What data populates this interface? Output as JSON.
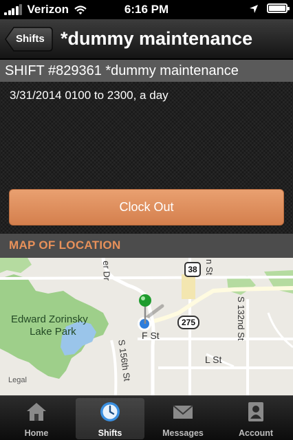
{
  "status_bar": {
    "carrier": "Verizon",
    "time": "6:16 PM",
    "battery_level": 1.0
  },
  "nav": {
    "back_label": "Shifts",
    "title": "*dummy maintenance"
  },
  "shift": {
    "header": "SHIFT #829361 *dummy maintenance",
    "detail": "3/31/2014 0100 to 2300, a day"
  },
  "actions": {
    "clock_out_label": "Clock Out"
  },
  "map": {
    "section_title": "MAP OF LOCATION",
    "park_name_line1": "Edward Zorinsky",
    "park_name_line2": "Lake Park",
    "route_38": "38",
    "route_275": "275",
    "streets": {
      "f_st": "F St",
      "l_st": "L St",
      "s_132nd": "S 132nd St",
      "s_156th": "S 156th St",
      "er_dr": "er Dr",
      "n_st": "n St"
    },
    "legal": "Legal"
  },
  "tabs": [
    {
      "label": "Home",
      "icon": "home-icon",
      "active": false
    },
    {
      "label": "Shifts",
      "icon": "clock-icon",
      "active": true
    },
    {
      "label": "Messages",
      "icon": "envelope-icon",
      "active": false
    },
    {
      "label": "Account",
      "icon": "account-icon",
      "active": false
    }
  ],
  "colors": {
    "accent_orange": "#e8915a",
    "button_orange": "#d98653",
    "active_tab_blue": "#3a8fe0"
  }
}
